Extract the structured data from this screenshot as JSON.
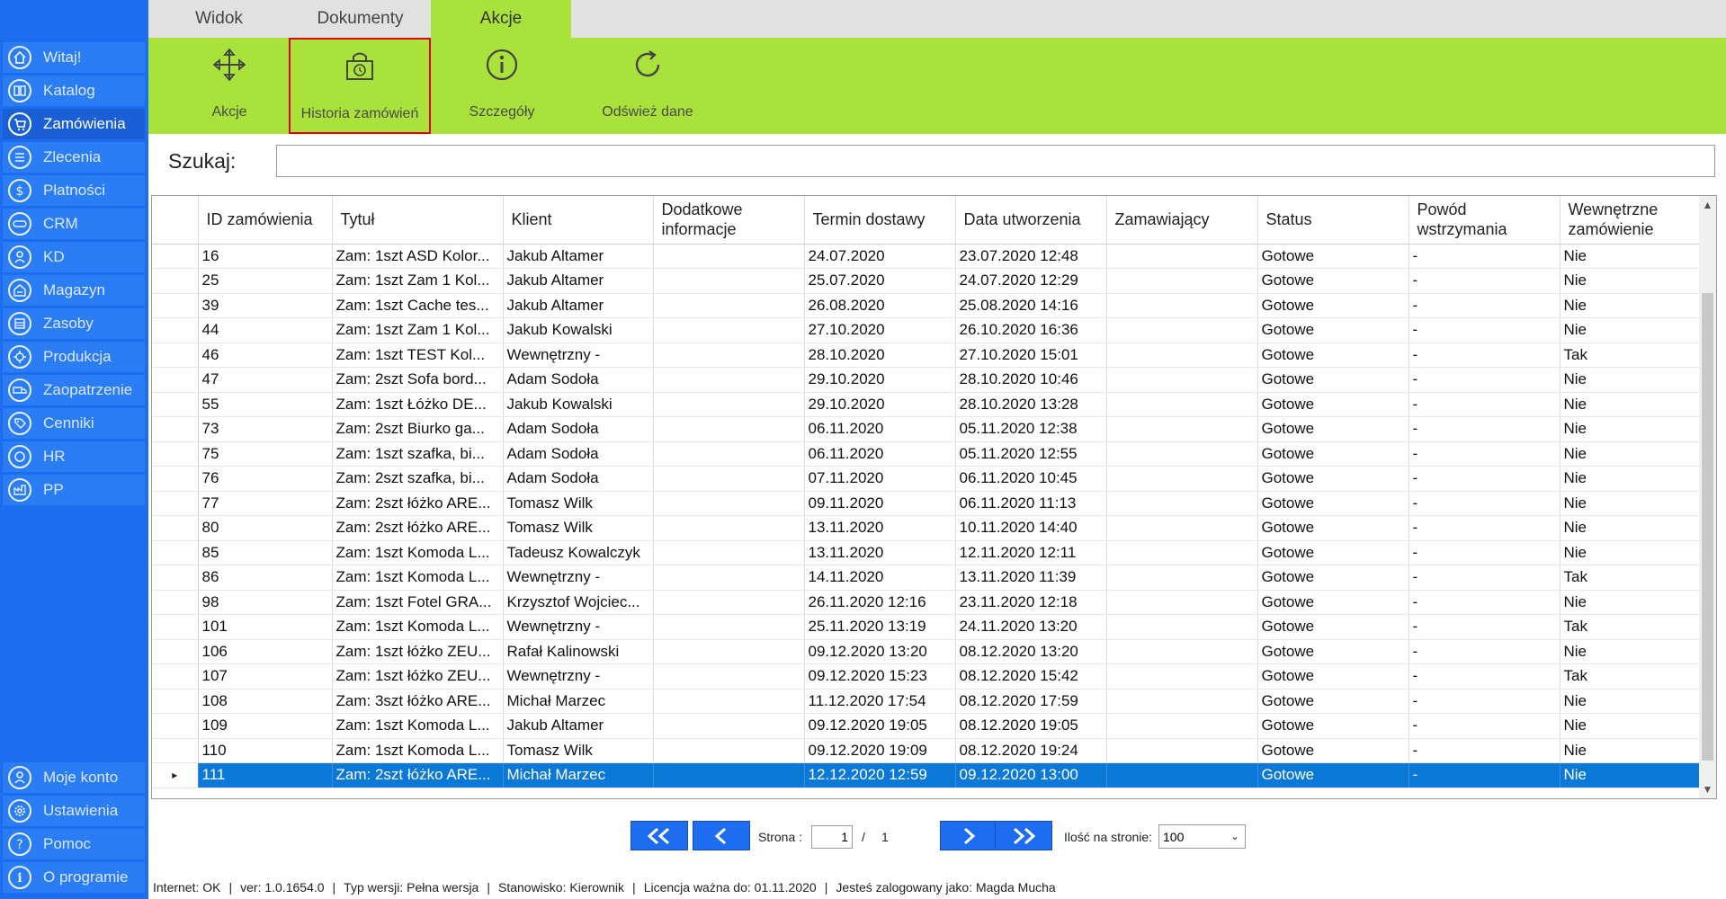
{
  "tabs": [
    {
      "label": "Widok",
      "active": false
    },
    {
      "label": "Dokumenty",
      "active": false
    },
    {
      "label": "Akcje",
      "active": true
    }
  ],
  "ribbon": {
    "buttons": [
      {
        "label": "Akcje",
        "icon": "move-arrows-icon"
      },
      {
        "label": "Historia zamówień",
        "icon": "bag-history-icon",
        "highlighted": true
      },
      {
        "label": "Szczegóły",
        "icon": "info-icon"
      },
      {
        "label": "Odśwież dane",
        "icon": "refresh-icon"
      }
    ]
  },
  "sidebar": {
    "items": [
      {
        "label": "Witaj!",
        "icon": "home-icon"
      },
      {
        "label": "Katalog",
        "icon": "book-icon"
      },
      {
        "label": "Zamówienia",
        "icon": "cart-icon",
        "active": true
      },
      {
        "label": "Zlecenia",
        "icon": "list-icon"
      },
      {
        "label": "Płatności",
        "icon": "dollar-icon"
      },
      {
        "label": "CRM",
        "icon": "crm-icon"
      },
      {
        "label": "KD",
        "icon": "person-icon"
      },
      {
        "label": "Magazyn",
        "icon": "warehouse-icon"
      },
      {
        "label": "Zasoby",
        "icon": "resources-icon"
      },
      {
        "label": "Produkcja",
        "icon": "production-icon"
      },
      {
        "label": "Zaopatrzenie",
        "icon": "truck-icon"
      },
      {
        "label": "Cenniki",
        "icon": "tag-icon"
      },
      {
        "label": "HR",
        "icon": "hr-icon"
      },
      {
        "label": "PP",
        "icon": "pp-icon"
      }
    ],
    "bottom_items": [
      {
        "label": "Moje konto",
        "icon": "account-icon"
      },
      {
        "label": "Ustawienia",
        "icon": "settings-icon"
      },
      {
        "label": "Pomoc",
        "icon": "help-icon"
      },
      {
        "label": "O programie",
        "icon": "about-icon"
      }
    ]
  },
  "search": {
    "label": "Szukaj:",
    "value": ""
  },
  "grid": {
    "columns": [
      "ID zamówienia",
      "Tytuł",
      "Klient",
      "Dodatkowe informacje",
      "Termin dostawy",
      "Data utworzenia",
      "Zamawiający",
      "Status",
      "Powód wstrzymania",
      "Wewnętrzne zamówienie"
    ],
    "rows": [
      [
        "16",
        "Zam: 1szt ASD Kolor...",
        "Jakub  Altamer",
        "",
        "24.07.2020",
        "23.07.2020 12:48",
        "",
        "Gotowe",
        "-",
        "Nie"
      ],
      [
        "25",
        "Zam: 1szt Zam 1 Kol...",
        "Jakub  Altamer",
        "",
        "25.07.2020",
        "24.07.2020 12:29",
        "",
        "Gotowe",
        "-",
        "Nie"
      ],
      [
        "39",
        "Zam: 1szt Cache tes...",
        "Jakub  Altamer",
        "",
        "26.08.2020",
        "25.08.2020 14:16",
        "",
        "Gotowe",
        "-",
        "Nie"
      ],
      [
        "44",
        "Zam: 1szt Zam 1 Kol...",
        "Jakub Kowalski",
        "",
        "27.10.2020",
        "26.10.2020 16:36",
        "",
        "Gotowe",
        "-",
        "Nie"
      ],
      [
        "46",
        "Zam: 1szt TEST Kol...",
        "Wewnętrzny -",
        "",
        "28.10.2020",
        "27.10.2020 15:01",
        "",
        "Gotowe",
        "-",
        "Tak"
      ],
      [
        "47",
        "Zam: 2szt Sofa bord...",
        "Adam Sodoła",
        "",
        "29.10.2020",
        "28.10.2020 10:46",
        "",
        "Gotowe",
        "-",
        "Nie"
      ],
      [
        "55",
        "Zam: 1szt Łóżko DE...",
        "Jakub Kowalski",
        "",
        "29.10.2020",
        "28.10.2020 13:28",
        "",
        "Gotowe",
        "-",
        "Nie"
      ],
      [
        "73",
        "Zam: 2szt Biurko ga...",
        "Adam Sodoła",
        "",
        "06.11.2020",
        "05.11.2020 12:38",
        "",
        "Gotowe",
        "-",
        "Nie"
      ],
      [
        "75",
        "Zam: 1szt szafka, bi...",
        "Adam Sodoła",
        "",
        "06.11.2020",
        "05.11.2020 12:55",
        "",
        "Gotowe",
        "-",
        "Nie"
      ],
      [
        "76",
        "Zam: 2szt szafka, bi...",
        "Adam Sodoła",
        "",
        "07.11.2020",
        "06.11.2020 10:45",
        "",
        "Gotowe",
        "-",
        "Nie"
      ],
      [
        "77",
        "Zam: 2szt łóżko ARE...",
        "Tomasz Wilk",
        "",
        "09.11.2020",
        "06.11.2020 11:13",
        "",
        "Gotowe",
        "-",
        "Nie"
      ],
      [
        "80",
        "Zam: 2szt łóżko ARE...",
        "Tomasz Wilk",
        "",
        "13.11.2020",
        "10.11.2020 14:40",
        "",
        "Gotowe",
        "-",
        "Nie"
      ],
      [
        "85",
        "Zam: 1szt Komoda L...",
        "Tadeusz Kowalczyk",
        "",
        "13.11.2020",
        "12.11.2020 12:11",
        "",
        "Gotowe",
        "-",
        "Nie"
      ],
      [
        "86",
        "Zam: 1szt Komoda L...",
        "Wewnętrzny -",
        "",
        "14.11.2020",
        "13.11.2020 11:39",
        "",
        "Gotowe",
        "-",
        "Tak"
      ],
      [
        "98",
        "Zam: 1szt Fotel GRA...",
        "Krzysztof Wojciec...",
        "",
        "26.11.2020 12:16",
        "23.11.2020 12:18",
        "",
        "Gotowe",
        "-",
        "Nie"
      ],
      [
        "101",
        "Zam: 1szt Komoda L...",
        "Wewnętrzny -",
        "",
        "25.11.2020 13:19",
        "24.11.2020 13:20",
        "",
        "Gotowe",
        "-",
        "Tak"
      ],
      [
        "106",
        "Zam: 1szt łóżko ZEU...",
        "Rafał  Kalinowski",
        "",
        "09.12.2020 13:20",
        "08.12.2020 13:20",
        "",
        "Gotowe",
        "-",
        "Nie"
      ],
      [
        "107",
        "Zam: 1szt łóżko ZEU...",
        "Wewnętrzny -",
        "",
        "09.12.2020 15:23",
        "08.12.2020 15:42",
        "",
        "Gotowe",
        "-",
        "Tak"
      ],
      [
        "108",
        "Zam: 3szt łóżko ARE...",
        "Michał Marzec",
        "",
        "11.12.2020 17:54",
        "08.12.2020 17:59",
        "",
        "Gotowe",
        "-",
        "Nie"
      ],
      [
        "109",
        "Zam: 1szt Komoda L...",
        "Jakub  Altamer",
        "",
        "09.12.2020 19:05",
        "08.12.2020 19:05",
        "",
        "Gotowe",
        "-",
        "Nie"
      ],
      [
        "110",
        "Zam: 1szt Komoda L...",
        "Tomasz Wilk",
        "",
        "09.12.2020 19:09",
        "08.12.2020 19:24",
        "",
        "Gotowe",
        "-",
        "Nie"
      ],
      [
        "111",
        "Zam: 2szt łóżko ARE...",
        "Michał Marzec",
        "",
        "12.12.2020 12:59",
        "09.12.2020 13:00",
        "",
        "Gotowe",
        "-",
        "Nie"
      ]
    ],
    "selected_row_index": 21,
    "row_indicator": "▸"
  },
  "pagination": {
    "page_label": "Strona :",
    "current_page": "1",
    "separator": "/",
    "total_pages": "1",
    "per_page_label": "Ilość na stronie:",
    "per_page_value": "100"
  },
  "statusbar": {
    "internet": "Internet: OK",
    "version": "ver: 1.0.1654.0",
    "edition": "Typ wersji: Pełna wersja",
    "station": "Stanowisko: Kierownik",
    "license": "Licencja ważna do: 01.11.2020",
    "user": "Jesteś zalogowany jako: Magda Mucha",
    "separator": "|"
  },
  "colors": {
    "sidebar": "#1e6cf0",
    "ribbon": "#a8e23a",
    "selection": "#0a78d7",
    "highlight_border": "#e00000"
  }
}
